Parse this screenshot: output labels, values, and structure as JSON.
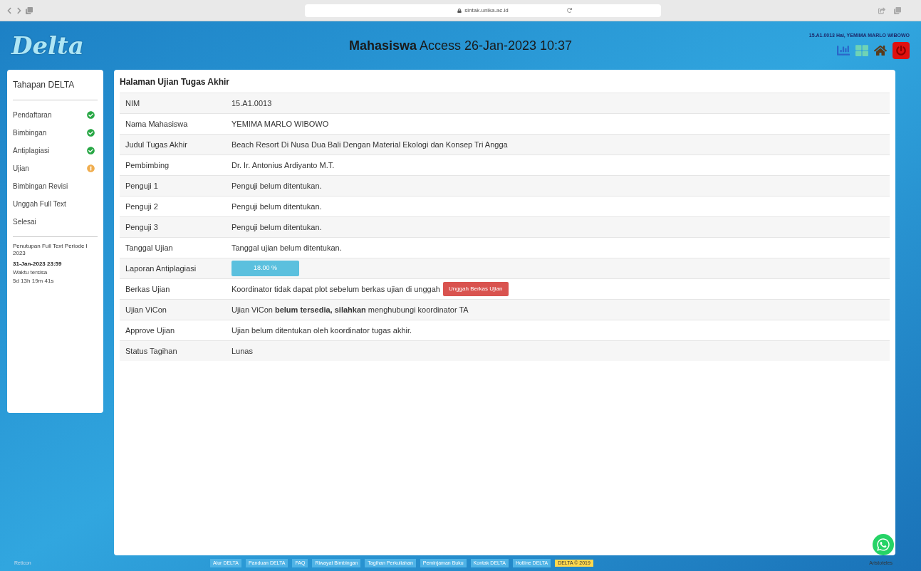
{
  "browser": {
    "address": "sintak.unika.ac.id"
  },
  "header": {
    "logo": "Delta",
    "title_bold": "Mahasiswa",
    "title_rest": "Access 26-Jan-2023 10:37",
    "user": "15.A1.0013 Hai, YEMIMA MARLO WIBOWO"
  },
  "sidebar": {
    "title": "Tahapan DELTA",
    "items": [
      {
        "label": "Pendaftaran",
        "kind": "done"
      },
      {
        "label": "Bimbingan",
        "kind": "done"
      },
      {
        "label": "Antiplagiasi",
        "kind": "done"
      },
      {
        "label": "Ujian",
        "kind": "pending"
      },
      {
        "label": "Bimbingan Revisi",
        "kind": "plain"
      },
      {
        "label": "Unggah Full Text",
        "kind": "plain"
      },
      {
        "label": "Selesai",
        "kind": "plain"
      }
    ],
    "deadline": {
      "title": "Penutupan Full Text Periode I 2023",
      "date": "31-Jan-2023 23:59",
      "remaining_label": "Waktu tersisa",
      "remaining": "5d 13h 19m 41s"
    }
  },
  "panel": {
    "title": "Halaman Ujian Tugas Akhir",
    "rows": [
      {
        "label": "NIM",
        "kind": "text",
        "value": "15.A1.0013"
      },
      {
        "label": "Nama Mahasiswa",
        "kind": "text",
        "value": "YEMIMA MARLO WIBOWO"
      },
      {
        "label": "Judul Tugas Akhir",
        "kind": "text",
        "value": "Beach Resort Di Nusa Dua Bali Dengan Material Ekologi dan Konsep Tri Angga"
      },
      {
        "label": "Pembimbing",
        "kind": "text",
        "value": "Dr. Ir. Antonius Ardiyanto M.T."
      },
      {
        "label": "Penguji 1",
        "kind": "text",
        "value": "Penguji belum ditentukan."
      },
      {
        "label": "Penguji 2",
        "kind": "text",
        "value": "Penguji belum ditentukan."
      },
      {
        "label": "Penguji 3",
        "kind": "text",
        "value": "Penguji belum ditentukan."
      },
      {
        "label": "Tanggal Ujian",
        "kind": "text",
        "value": "Tanggal ujian belum ditentukan."
      },
      {
        "label": "Laporan Antiplagiasi",
        "kind": "badge",
        "value": "18.00 %"
      },
      {
        "label": "Berkas Ujian",
        "kind": "button",
        "value": "Koordinator tidak dapat plot sebelum berkas ujian di unggah",
        "button": "Unggah Berkas Ujian"
      },
      {
        "label": "Ujian ViCon",
        "kind": "text",
        "value": "Ujian ViCon **belum tersedia, silahkan** menghubungi koordinator TA"
      },
      {
        "label": "Approve Ujian",
        "kind": "text",
        "value": "Ujian belum ditentukan oleh koordinator tugas akhir."
      },
      {
        "label": "Status Tagihan",
        "kind": "text",
        "value": "Lunas"
      }
    ]
  },
  "footer": {
    "left": "Reticon",
    "links": [
      "Alur DELTA",
      "Panduan DELTA",
      "FAQ",
      "Riwayat Bimbingan",
      "Tagihan Perkuliahan",
      "Peminjaman Buku",
      "Kontak DELTA",
      "Hotline DELTA"
    ],
    "copyright": "DELTA © 2019",
    "right": "Aristoteles"
  }
}
